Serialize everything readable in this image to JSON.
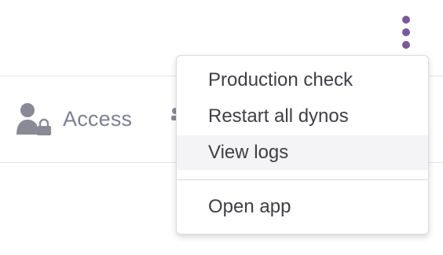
{
  "header": {
    "more_menu_icon": "vertical-ellipsis-icon",
    "accent_color": "#79589f"
  },
  "nav": {
    "items": [
      {
        "label": "Access",
        "icon": "user-lock-icon"
      }
    ],
    "partial_icon": "partially-hidden-icon"
  },
  "dropdown": {
    "items": [
      {
        "label": "Production check"
      },
      {
        "label": "Restart all dynos"
      },
      {
        "label": "View logs",
        "highlighted": true
      },
      {
        "label": "Open app"
      }
    ],
    "highlight_color": "#f4f4f6",
    "text_color": "#3f3f44"
  }
}
